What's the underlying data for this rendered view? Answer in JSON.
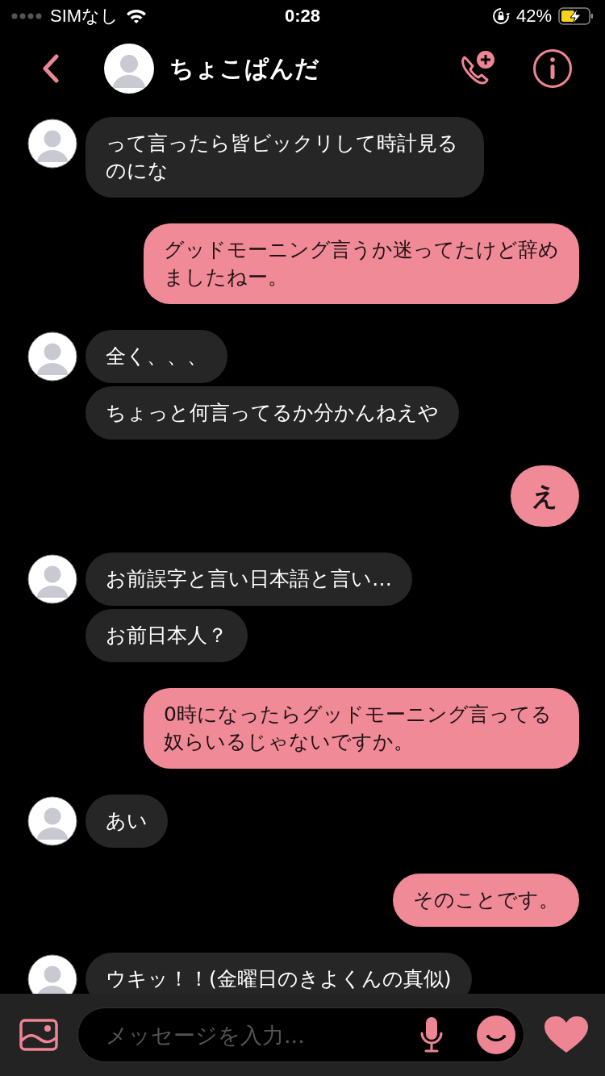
{
  "status_bar": {
    "carrier": "SIMなし",
    "time": "0:28",
    "battery": "42%"
  },
  "header": {
    "name": "ちょこぱんだ"
  },
  "groups": [
    {
      "kind": "incoming",
      "bubbles": [
        {
          "kind": "text",
          "text": "って言ったら皆ビックリして時計見るのにな"
        }
      ]
    },
    {
      "kind": "outgoing",
      "bubbles": [
        {
          "kind": "text",
          "text": "グッドモーニング言うか迷ってたけど辞めましたねー。"
        }
      ]
    },
    {
      "kind": "incoming",
      "bubbles": [
        {
          "kind": "text",
          "text": "全く、、、"
        },
        {
          "kind": "text",
          "text": "ちょっと何言ってるか分かんねえや"
        }
      ]
    },
    {
      "kind": "outgoing",
      "bubbles": [
        {
          "kind": "large",
          "text": "え"
        }
      ]
    },
    {
      "kind": "incoming",
      "bubbles": [
        {
          "kind": "text",
          "text": "お前誤字と言い日本語と言い…"
        },
        {
          "kind": "text",
          "text": "お前日本人？"
        }
      ]
    },
    {
      "kind": "outgoing",
      "bubbles": [
        {
          "kind": "text",
          "text": "0時になったらグッドモーニング言ってる奴らいるじゃないですか。"
        }
      ]
    },
    {
      "kind": "incoming",
      "bubbles": [
        {
          "kind": "text",
          "text": "あい"
        }
      ]
    },
    {
      "kind": "outgoing",
      "bubbles": [
        {
          "kind": "text",
          "text": "そのことです。"
        }
      ]
    },
    {
      "kind": "incoming",
      "bubbles": [
        {
          "kind": "text",
          "text": "ウキッ！！(金曜日のきよくんの真似)"
        }
      ]
    }
  ],
  "composer": {
    "placeholder": "メッセージを入力..."
  }
}
